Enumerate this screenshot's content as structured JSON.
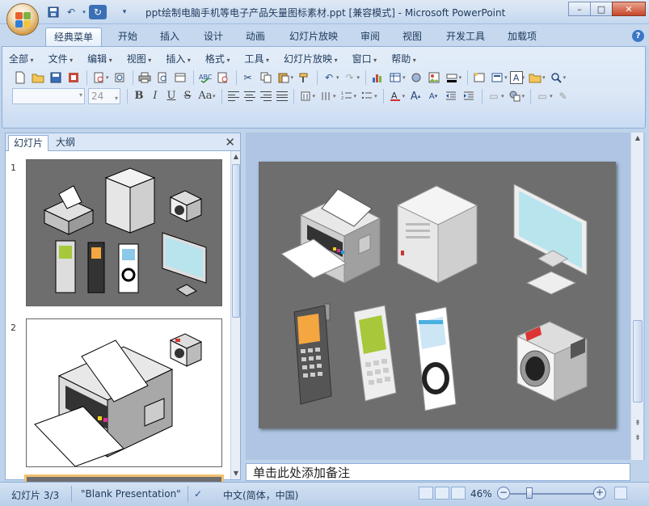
{
  "window": {
    "title": "ppt绘制电脑手机等电子产品矢量图标素材.ppt [兼容模式] - Microsoft PowerPoint",
    "minimize": "–",
    "maximize": "□",
    "close": "✕"
  },
  "tabs": [
    "经典菜单",
    "开始",
    "插入",
    "设计",
    "动画",
    "幻灯片放映",
    "审阅",
    "视图",
    "开发工具",
    "加载项"
  ],
  "active_tab": "经典菜单",
  "help": "?",
  "menu": [
    "全部",
    "文件",
    "编辑",
    "视图",
    "插入",
    "格式",
    "工具",
    "幻灯片放映",
    "窗口",
    "帮助"
  ],
  "font_size": "24",
  "format_buttons": [
    "B",
    "I",
    "U",
    "S",
    "Aa"
  ],
  "pane": {
    "tab_slides": "幻灯片",
    "tab_outline": "大纲",
    "close": "✕",
    "slides": [
      {
        "number": "1"
      },
      {
        "number": "2"
      }
    ]
  },
  "notes": {
    "placeholder": "单击此处添加备注"
  },
  "status": {
    "slide": "幻灯片 3/3",
    "theme": "\"Blank Presentation\"",
    "language": "中文(简体，中国)",
    "zoom": "46%",
    "zoom_level": 0.46
  },
  "colors": {
    "slide_bg": "#6e6e6e",
    "ribbon_bg": "#dbe7f6",
    "accent": "#3b78c6"
  }
}
